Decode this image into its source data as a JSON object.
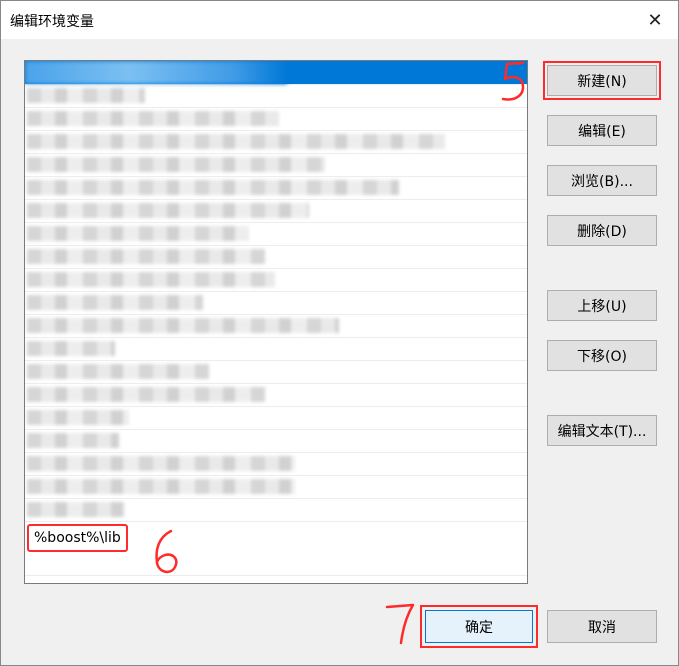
{
  "window": {
    "title": "编辑环境变量",
    "close_icon": "close-icon"
  },
  "list": {
    "new_entry_value": "%boost%\\lib"
  },
  "buttons": {
    "new": "新建(N)",
    "edit": "编辑(E)",
    "browse": "浏览(B)...",
    "delete": "删除(D)",
    "move_up": "上移(U)",
    "move_down": "下移(O)",
    "edit_text": "编辑文本(T)...",
    "ok": "确定",
    "cancel": "取消"
  },
  "annotations": {
    "step5": "5",
    "step6": "6",
    "step7": "7",
    "color": "#ff2b2b"
  },
  "colors": {
    "selection": "#0078d7",
    "highlight_box": "#ff2b2b"
  }
}
